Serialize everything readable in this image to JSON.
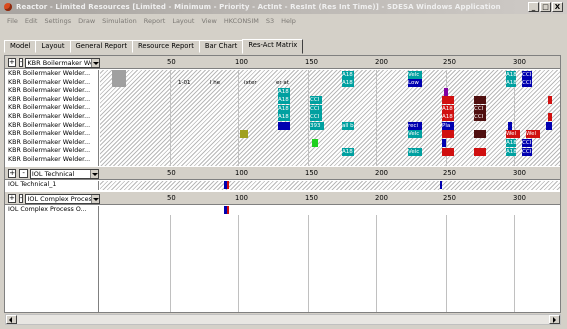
{
  "window": {
    "title": "Reactor - Limited Resources [Limited - Minimum - Priority - ActInt - ResInt (Res Int Time)] - SDESA Windows Application",
    "minimize": "_",
    "maximize": "□",
    "close": "X"
  },
  "menu": [
    "File",
    "Edit",
    "Settings",
    "Draw",
    "Simulation",
    "Report",
    "Layout",
    "View",
    "HKCONSIM",
    "S3",
    "Help"
  ],
  "tabs": [
    "Model",
    "Layout",
    "General Report",
    "Resource Report",
    "Bar Chart",
    "Res-Act Matrix"
  ],
  "active_tab": "Res-Act Matrix",
  "sections": [
    {
      "combo_value": "KBR Boilermaker Welder",
      "ticks": [
        "50",
        "100",
        "150",
        "200",
        "250",
        "300"
      ],
      "rows": [
        "KBR Boilermaker Welder...",
        "KBR Boilermaker Welder...",
        "KBR Boilermaker Welder...",
        "KBR Boilermaker Welder...",
        "KBR Boilermaker Welder...",
        "KBR Boilermaker Welder...",
        "KBR Boilermaker Welder...",
        "KBR Boilermaker Welder...",
        "KBR Boilermaker Welder...",
        "KBR Boilermaker Welder...",
        "KBR Boilermaker Welder..."
      ]
    },
    {
      "combo_value": "IOL Technical",
      "ticks": [
        "50",
        "100",
        "150",
        "200",
        "250",
        "300"
      ],
      "rows": [
        "IOL Technical_1"
      ]
    },
    {
      "combo_value": "IOL Complex Process Op",
      "ticks": [
        "50",
        "100",
        "150",
        "200",
        "250",
        "300"
      ],
      "rows": [
        "IOL Complex Process O..."
      ]
    }
  ],
  "bar_texts": {
    "r0": [
      "A18",
      "Velc",
      "A18",
      "CCI"
    ],
    "r1": [
      "1-01",
      "l he",
      "ixter",
      "er at",
      "A18",
      "Low",
      "A18",
      "CCI"
    ],
    "r2": [
      "A18"
    ],
    "r3": [
      "A18",
      "CCI"
    ],
    "r4": [
      "A18",
      "CCI",
      "A18",
      "CCI"
    ],
    "r5": [
      "A18",
      "CCI",
      "A18",
      "CCI"
    ],
    "r6": [
      "393",
      "all b",
      "reci",
      "Pla"
    ],
    "r7": [
      "Velc",
      "Wel",
      "Wel"
    ],
    "r8": [
      "A18",
      "CCI"
    ],
    "r9": [
      "A18",
      "Velc",
      "A18",
      "CCI"
    ]
  },
  "plus_label": "+",
  "minus_label": "-"
}
